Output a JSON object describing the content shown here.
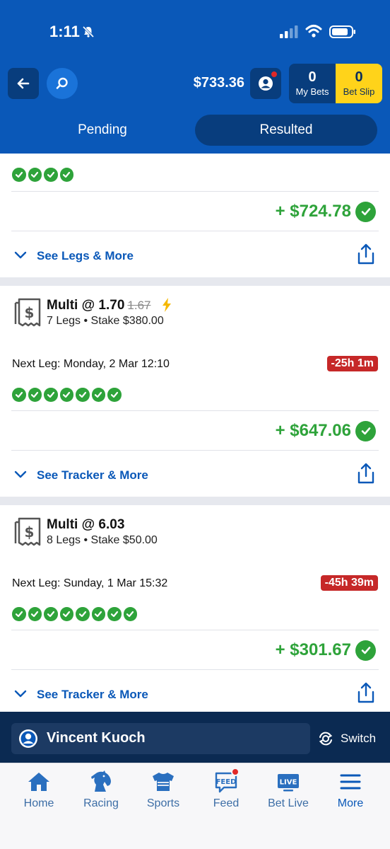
{
  "status_bar": {
    "time": "1:11"
  },
  "header": {
    "balance": "$733.36",
    "my_bets": {
      "count": "0",
      "label": "My Bets"
    },
    "bet_slip": {
      "count": "0",
      "label": "Bet Slip"
    },
    "tabs": [
      {
        "label": "Pending",
        "active": false
      },
      {
        "label": "Resulted",
        "active": true
      }
    ]
  },
  "cards": [
    {
      "legs_won": 4,
      "payout": "+ $724.78",
      "action_label": "See Legs & More"
    },
    {
      "title": "Multi @ 1.70",
      "old_odds": "1.67",
      "subtitle": "7 Legs • Stake $380.00",
      "next_leg": "Next Leg: Monday, 2 Mar 12:10",
      "timer": "-25h 1m",
      "legs_won": 7,
      "payout": "+ $647.06",
      "action_label": "See Tracker & More"
    },
    {
      "title": "Multi @ 6.03",
      "subtitle": "8 Legs • Stake $50.00",
      "next_leg": "Next Leg: Sunday, 1 Mar 15:32",
      "timer": "-45h 39m",
      "legs_won": 8,
      "payout": "+ $301.67",
      "action_label": "See Tracker & More"
    }
  ],
  "account": {
    "name": "Vincent Kuoch",
    "switch_label": "Switch"
  },
  "bottom_nav": [
    {
      "label": "Home",
      "icon": "home-icon"
    },
    {
      "label": "Racing",
      "icon": "horse-icon"
    },
    {
      "label": "Sports",
      "icon": "jersey-icon"
    },
    {
      "label": "Feed",
      "icon": "feed-icon"
    },
    {
      "label": "Bet Live",
      "icon": "live-icon"
    },
    {
      "label": "More",
      "icon": "menu-icon",
      "active": true
    }
  ],
  "colors": {
    "brand_blue": "#0a58b8",
    "dark_blue": "#083d7d",
    "win_green": "#2ea33a",
    "bet_slip_yellow": "#ffd31a",
    "timer_red": "#c62828"
  }
}
